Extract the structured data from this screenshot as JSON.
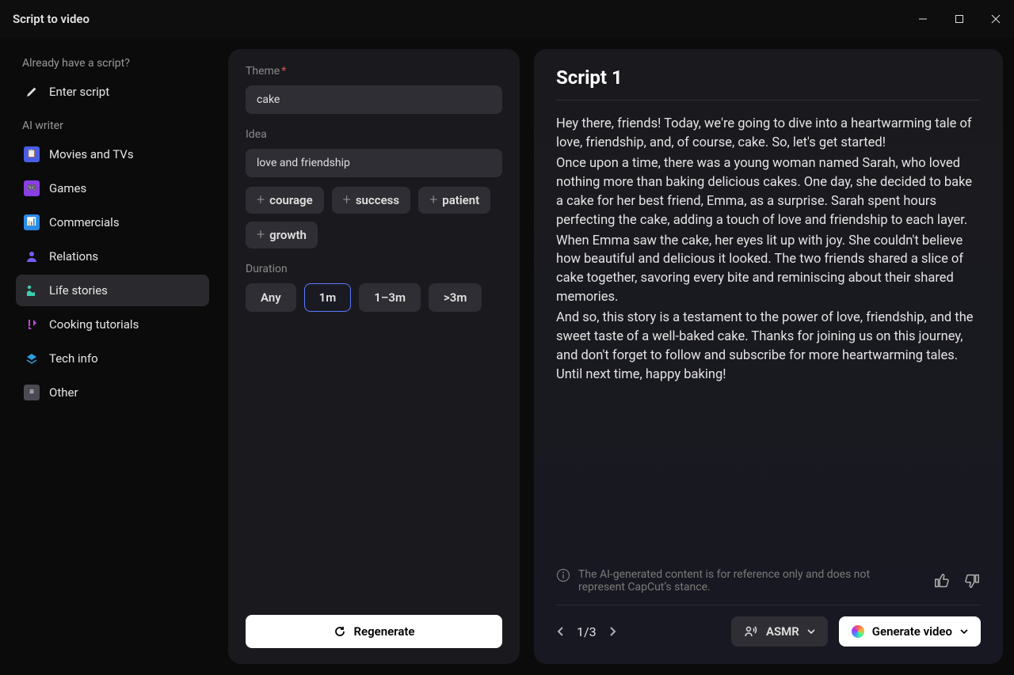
{
  "window_title": "Script to video",
  "sidebar": {
    "already_label": "Already have a script?",
    "enter_script": "Enter script",
    "ai_writer_label": "AI writer",
    "items": [
      {
        "label": "Movies and TVs"
      },
      {
        "label": "Games"
      },
      {
        "label": "Commercials"
      },
      {
        "label": "Relations"
      },
      {
        "label": "Life stories"
      },
      {
        "label": "Cooking tutorials"
      },
      {
        "label": "Tech info"
      },
      {
        "label": "Other"
      }
    ]
  },
  "form": {
    "theme_label": "Theme",
    "theme_value": "cake",
    "idea_label": "Idea",
    "idea_value": "love and friendship",
    "chips": [
      "courage",
      "success",
      "patient",
      "growth"
    ],
    "duration_label": "Duration",
    "durations": [
      "Any",
      "1m",
      "1–3m",
      ">3m"
    ]
  },
  "regenerate_label": "Regenerate",
  "script": {
    "title": "Script 1",
    "p1": "Hey there, friends! Today, we're going to dive into a heartwarming tale of love, friendship, and, of course, cake. So, let's get started!",
    "p2": "Once upon a time, there was a young woman named Sarah, who loved nothing more than baking delicious cakes. One day, she decided to bake a cake for her best friend, Emma, as a surprise. Sarah spent hours perfecting the cake, adding a touch of love and friendship to each layer.",
    "p3": "When Emma saw the cake, her eyes lit up with joy. She couldn't believe how beautiful and delicious it looked. The two friends shared a slice of cake together, savoring every bite and reminiscing about their shared memories.",
    "p4": "And so, this story is a testament to the power of love, friendship, and the sweet taste of a well-baked cake. Thanks for joining us on this journey, and don't forget to follow and subscribe for more heartwarming tales. Until next time, happy baking!"
  },
  "disclaimer": "The AI-generated content is for reference only and does not represent CapCut’s stance.",
  "pager": "1/3",
  "asmr_label": "ASMR",
  "generate_label": "Generate video"
}
